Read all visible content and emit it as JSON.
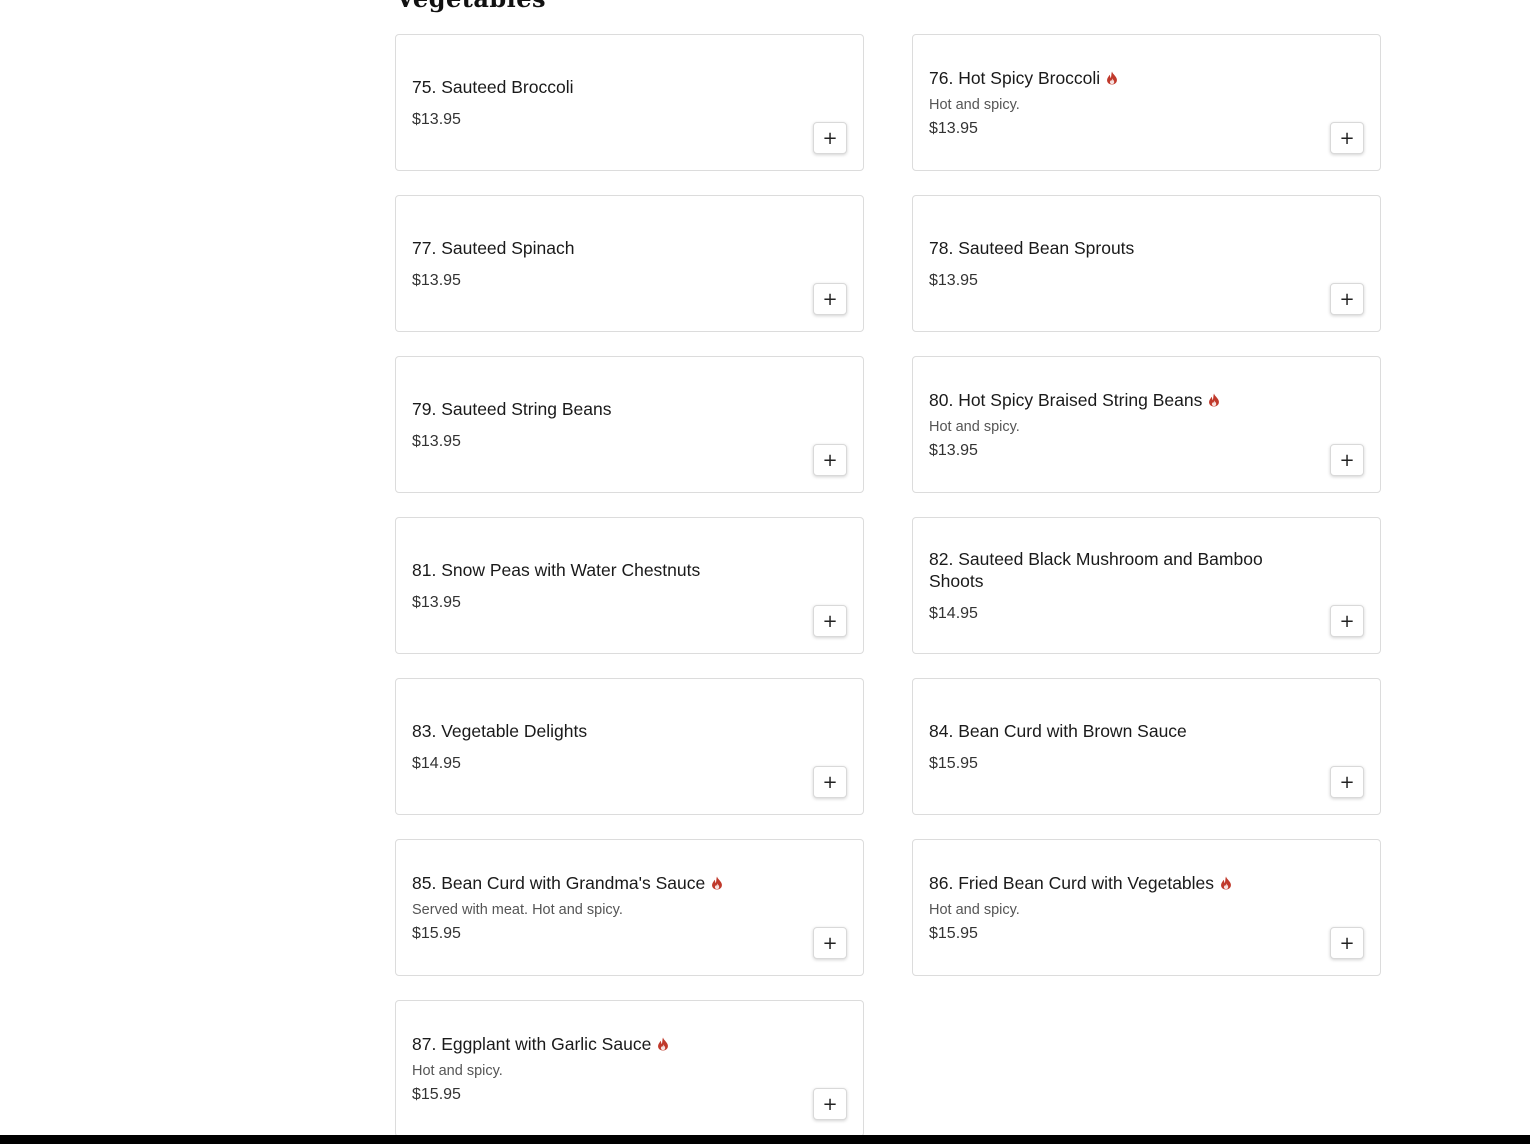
{
  "section": {
    "title": "Vegetables"
  },
  "colors": {
    "spicy": "#c0392b",
    "border": "#dcdcdc"
  },
  "add_icon": "+",
  "items": [
    {
      "name": "75. Sauteed Broccoli",
      "desc": "",
      "price": "$13.95",
      "spicy": false
    },
    {
      "name": "76. Hot Spicy Broccoli",
      "desc": "Hot and spicy.",
      "price": "$13.95",
      "spicy": true
    },
    {
      "name": "77. Sauteed Spinach",
      "desc": "",
      "price": "$13.95",
      "spicy": false
    },
    {
      "name": "78. Sauteed Bean Sprouts",
      "desc": "",
      "price": "$13.95",
      "spicy": false
    },
    {
      "name": "79. Sauteed String Beans",
      "desc": "",
      "price": "$13.95",
      "spicy": false
    },
    {
      "name": "80. Hot Spicy Braised String Beans",
      "desc": "Hot and spicy.",
      "price": "$13.95",
      "spicy": true
    },
    {
      "name": "81. Snow Peas with Water Chestnuts",
      "desc": "",
      "price": "$13.95",
      "spicy": false
    },
    {
      "name": "82. Sauteed Black Mushroom and Bamboo Shoots",
      "desc": "",
      "price": "$14.95",
      "spicy": false
    },
    {
      "name": "83. Vegetable Delights",
      "desc": "",
      "price": "$14.95",
      "spicy": false
    },
    {
      "name": "84. Bean Curd with Brown Sauce",
      "desc": "",
      "price": "$15.95",
      "spicy": false
    },
    {
      "name": "85. Bean Curd with Grandma's Sauce",
      "desc": "Served with meat. Hot and spicy.",
      "price": "$15.95",
      "spicy": true
    },
    {
      "name": "86. Fried Bean Curd with Vegetables",
      "desc": "Hot and spicy.",
      "price": "$15.95",
      "spicy": true
    },
    {
      "name": "87. Eggplant with Garlic Sauce",
      "desc": "Hot and spicy.",
      "price": "$15.95",
      "spicy": true
    }
  ]
}
